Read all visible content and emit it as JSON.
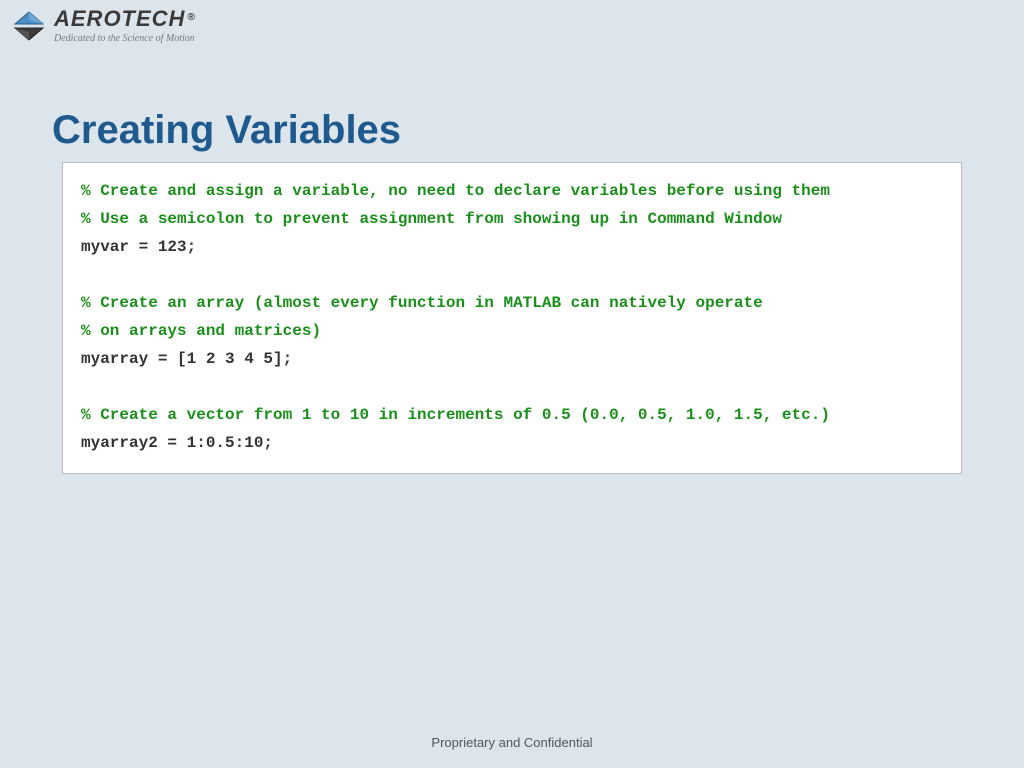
{
  "logo": {
    "name": "AEROTECH",
    "registered": "®",
    "tagline": "Dedicated to the Science of Motion"
  },
  "title": "Creating Variables",
  "code": {
    "line1": "% Create and assign a variable, no need to declare variables before using them",
    "line2": "% Use a semicolon to prevent assignment from showing up in Command Window",
    "line3": "myvar = 123;",
    "line4": "% Create an array (almost every function in MATLAB can natively operate",
    "line5": "% on arrays and matrices)",
    "line6": "myarray = [1 2 3 4 5];",
    "line7": "% Create a vector from 1 to 10 in increments of 0.5 (0.0, 0.5, 1.0, 1.5, etc.)",
    "line8": "myarray2 = 1:0.5:10;"
  },
  "footer": "Proprietary and Confidential"
}
